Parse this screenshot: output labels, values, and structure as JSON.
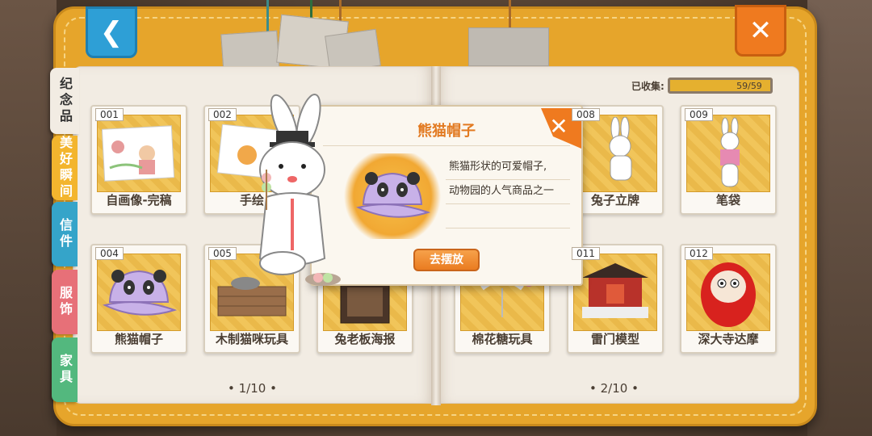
{
  "nav": {
    "back_icon": "chevron-left-icon",
    "close_icon": "close-icon"
  },
  "tabs": [
    {
      "label": "纪念品"
    },
    {
      "label": "美好瞬间"
    },
    {
      "label": "信件"
    },
    {
      "label": "服饰"
    },
    {
      "label": "家具"
    }
  ],
  "collected": {
    "label": "已收集:",
    "value": "59/59",
    "progress": 1.0
  },
  "left_page": {
    "items": [
      {
        "num": "001",
        "label": "自画像-完稿"
      },
      {
        "num": "002",
        "label": "手绘"
      },
      {
        "num": "004",
        "label": "熊猫帽子"
      },
      {
        "num": "005",
        "label": "木制猫咪玩具"
      },
      {
        "num": "",
        "label": "兔老板海报"
      }
    ],
    "pager": "• 1/10 •"
  },
  "right_page": {
    "items": [
      {
        "num": "008",
        "label": "兔子立牌"
      },
      {
        "num": "009",
        "label": "笔袋"
      },
      {
        "num": "",
        "label": "棉花糖玩具"
      },
      {
        "num": "011",
        "label": "雷门模型"
      },
      {
        "num": "012",
        "label": "深大寺达摩"
      }
    ],
    "pager": "• 2/10 •"
  },
  "popup": {
    "title": "熊猫帽子",
    "desc_line1": "熊猫形状的可爱帽子,",
    "desc_line2": "动物园的人气商品之一",
    "action": "去摆放"
  },
  "colors": {
    "accent": "#ef7a1f",
    "book": "#e6a52b",
    "back": "#2e9fd6"
  }
}
